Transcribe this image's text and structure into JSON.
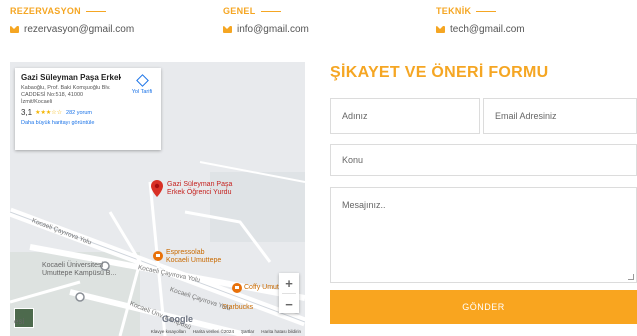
{
  "contacts": [
    {
      "heading": "REZERVASYON",
      "email": "rezervasyon@gmail.com"
    },
    {
      "heading": "GENEL",
      "email": "info@gmail.com"
    },
    {
      "heading": "TEKNİK",
      "email": "tech@gmail.com"
    }
  ],
  "map": {
    "place_name": "Gazi Süleyman Paşa Erkek Öğ...",
    "address_lines": [
      "Kabaoğlu, Prof. Baki Komşuoğlu Blv.",
      "CADDESİ No:518, 41000",
      "İzmit/Kocaeli"
    ],
    "rating": "3,1",
    "stars": "★★★☆☆",
    "reviews": "282 yorum",
    "larger_map_link": "Daha büyük haritayı görüntüle",
    "directions_label": "Yol Tarifi",
    "pin_label_line1": "Gazi Süleyman Paşa",
    "pin_label_line2": "Erkek Öğrenci Yurdu",
    "poi_espresso_line1": "Espressolab",
    "poi_espresso_line2": "Kocaeli Umuttepe",
    "poi_university_line1": "Kocaeli Üniversitesi",
    "poi_university_line2": "Umuttepe Kampüsü B...",
    "poi_coffy": "Coffy Umutt",
    "poi_starbucks": "Starbucks",
    "road_1": "Kocaeli Çayırova Yolu",
    "road_2": "Kocaeli Çayırova Yolu",
    "road_3": "Kocaeli Çayırova Yolu",
    "road_4": "Kocaeli Ünv. Kampüsü",
    "partial_label": "esi",
    "google_logo": "Google",
    "zoom_in": "+",
    "zoom_out": "−",
    "footer": [
      "Klavye kısayolları",
      "Harita verileri ©2024",
      "Şartlar",
      "Harita hatası bildirin"
    ]
  },
  "form": {
    "title": "ŞİKAYET VE ÖNERİ FORMU",
    "name_placeholder": "Adınız",
    "email_placeholder": "Email Adresiniz",
    "subject_placeholder": "Konu",
    "message_placeholder": "Mesajınız..",
    "submit_label": "GÖNDER"
  },
  "colors": {
    "accent": "#f9a51f",
    "pin": "#d93025",
    "poi_orange": "#e8710a",
    "link": "#1a73e8"
  }
}
